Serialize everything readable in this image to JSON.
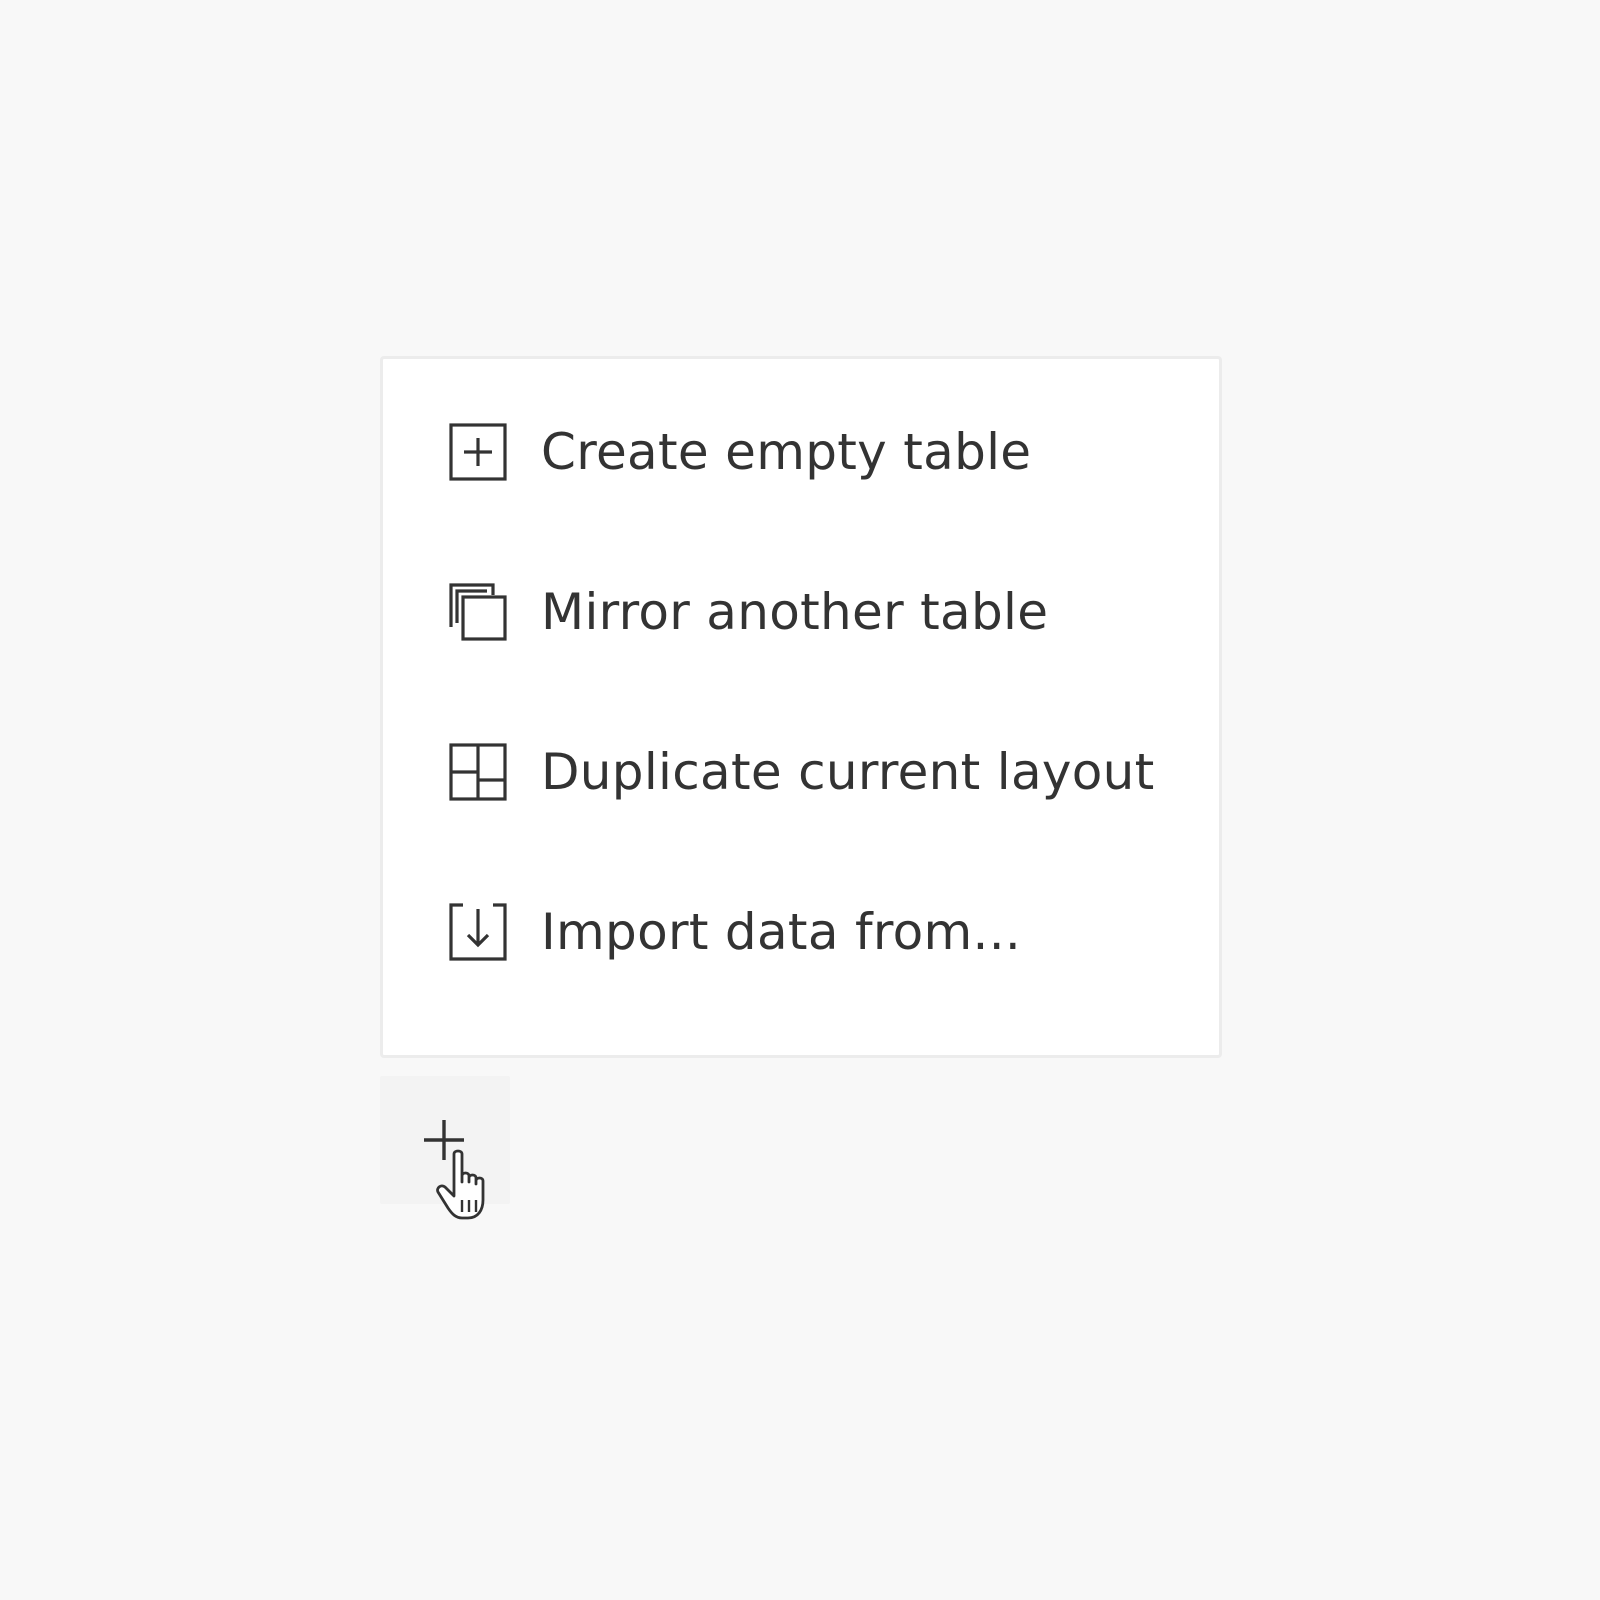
{
  "menu": {
    "items": [
      {
        "label": "Create empty table",
        "icon": "square-plus-icon"
      },
      {
        "label": "Mirror another table",
        "icon": "copy-layers-icon"
      },
      {
        "label": "Duplicate current layout",
        "icon": "layout-grid-icon"
      },
      {
        "label": "Import data from...",
        "icon": "import-down-arrow-icon"
      }
    ]
  },
  "add_button": {
    "icon": "plus-icon"
  },
  "cursor": {
    "icon": "hand-pointer-cursor-icon"
  },
  "colors": {
    "background": "#f8f8f8",
    "menu_background": "#ffffff",
    "menu_border": "#ececec",
    "text": "#333333",
    "button_hover": "#f3f3f3"
  }
}
